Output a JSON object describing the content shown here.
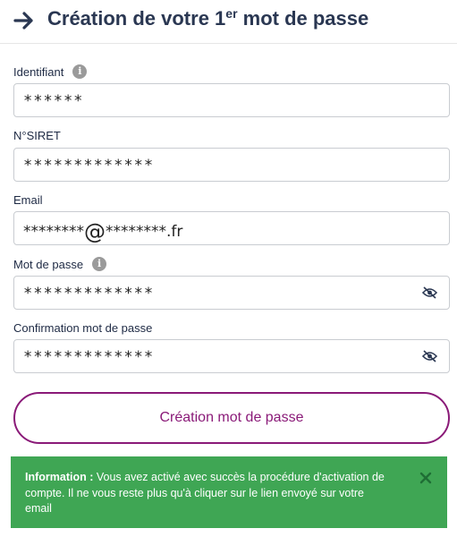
{
  "header": {
    "title_part1": "Création de votre 1",
    "title_sup": "er",
    "title_part2": " mot de passe",
    "back_icon": "arrow-right-icon"
  },
  "form": {
    "identifiant": {
      "label": "Identifiant",
      "value": "******",
      "info_icon": "info-icon"
    },
    "siret": {
      "label": "N°SIRET",
      "value": "*************"
    },
    "email": {
      "label": "Email",
      "value_local": "********",
      "value_at": "@",
      "value_domain": "********",
      "value_tld": ".fr"
    },
    "password": {
      "label": "Mot de passe",
      "value": "*************",
      "info_icon": "info-icon",
      "toggle_icon": "eye-off-icon"
    },
    "password_confirm": {
      "label": "Confirmation mot de passe",
      "value": "*************",
      "toggle_icon": "eye-off-icon"
    },
    "submit_label": "Création mot de passe"
  },
  "alert": {
    "title": "Information :",
    "message": " Vous avez activé avec succès la procédure d'activation de compte. Il ne vous reste plus qu'à cliquer sur le lien envoyé sur votre email",
    "close_icon": "close-icon"
  },
  "colors": {
    "title": "#2a3752",
    "accent": "#8a1a78",
    "success": "#3fa654",
    "border": "#c9ccd1"
  }
}
